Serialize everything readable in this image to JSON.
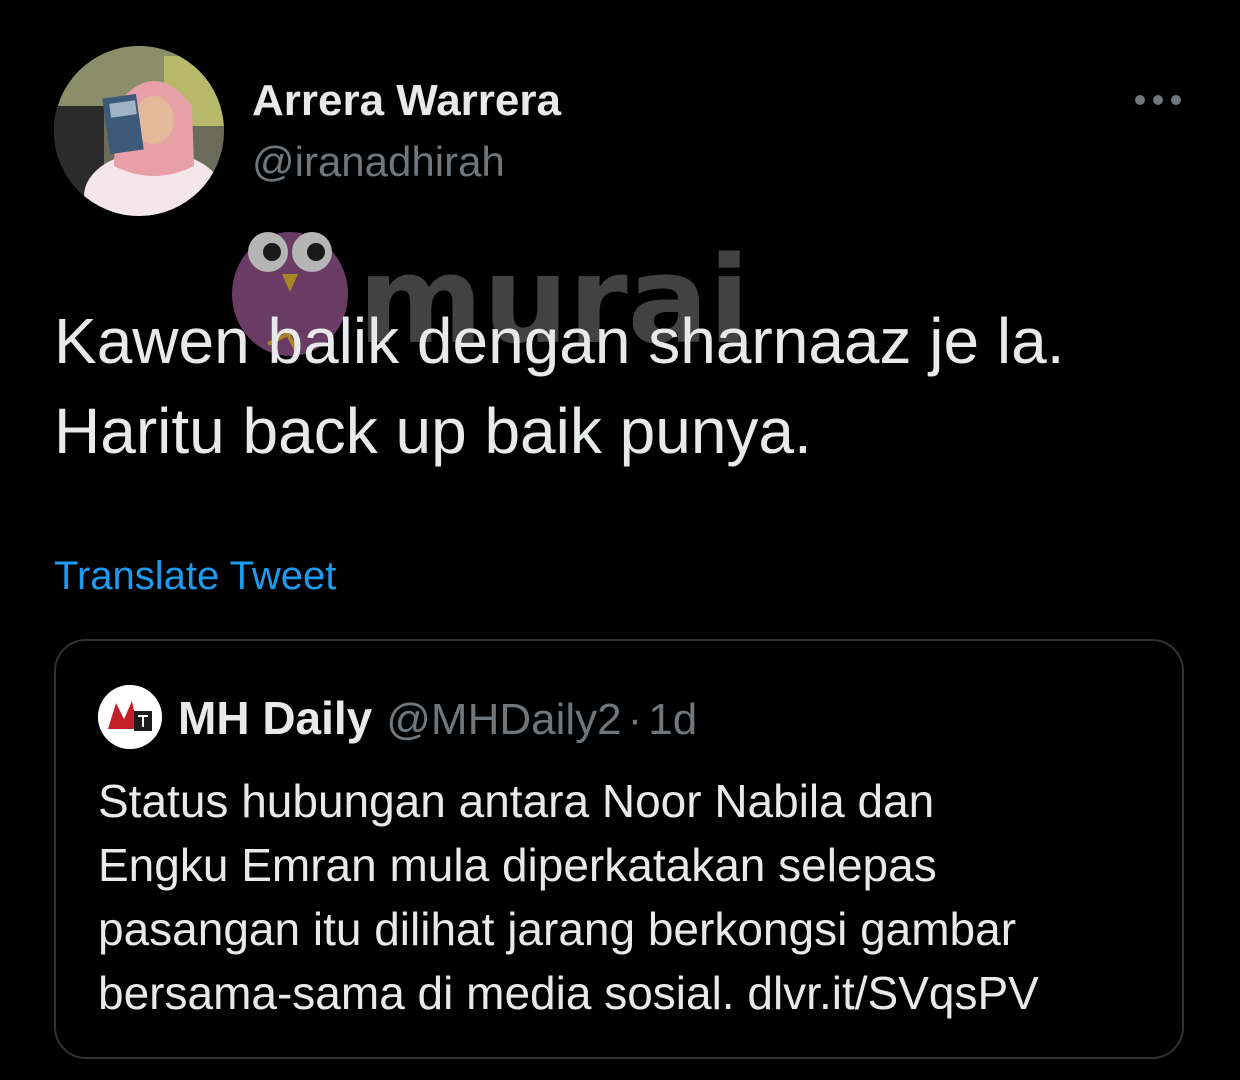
{
  "tweet": {
    "author_name": "Arrera Warrera",
    "author_handle": "@iranadhirah",
    "avatar_icon": "profile-photo",
    "more_icon": "more-dots-icon",
    "text_lines": [
      "Kawen balik dengan sharnaaz je la.",
      "Haritu back up baik punya."
    ],
    "translate_label": "Translate Tweet"
  },
  "watermark": {
    "text": "murai",
    "icon": "owl-logo-icon"
  },
  "quote": {
    "author_name": "MH Daily",
    "author_handle": "@MHDaily2",
    "separator": "·",
    "time": "1d",
    "avatar_icon": "mh-daily-logo",
    "text_lines": [
      "Status hubungan antara Noor Nabila dan",
      "Engku Emran mula diperkatakan selepas",
      "pasangan itu dilihat jarang berkongsi gambar",
      "bersama-sama di media sosial. dlvr.it/SVqsPV"
    ]
  },
  "colors": {
    "background": "#000000",
    "text_primary": "#e7e9ea",
    "text_secondary": "#71767b",
    "link": "#1d9bf0",
    "border": "#2f3336"
  }
}
